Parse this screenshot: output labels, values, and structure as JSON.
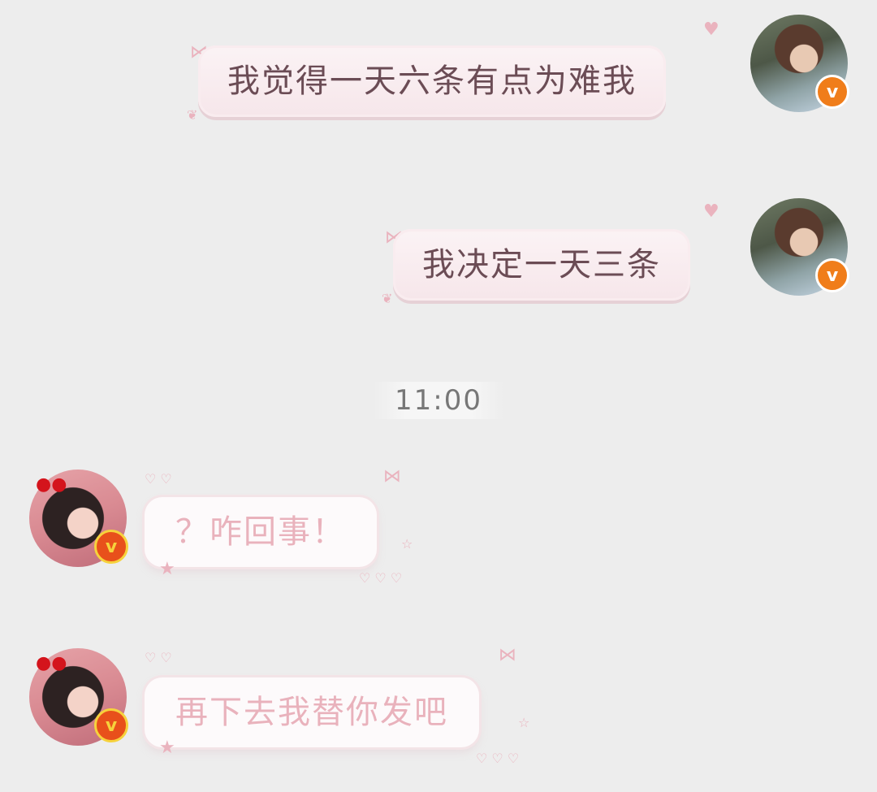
{
  "messages": [
    {
      "side": "out",
      "text": "我觉得一天六条有点为难我"
    },
    {
      "side": "out",
      "text": "我决定一天三条"
    },
    {
      "side": "in",
      "text": "？咋回事！"
    },
    {
      "side": "in",
      "text": "再下去我替你发吧"
    }
  ],
  "timestamp": "11:00",
  "badge": {
    "verified_label": "v"
  },
  "icons": {
    "verified": "verified-v-icon",
    "heart": "heart-icon",
    "bow": "bow-icon",
    "star": "star-icon"
  },
  "colors": {
    "background": "#ededed",
    "out_text": "#6b4c55",
    "in_text": "#e9b2bc",
    "badge_orange": "#f07d1a"
  }
}
